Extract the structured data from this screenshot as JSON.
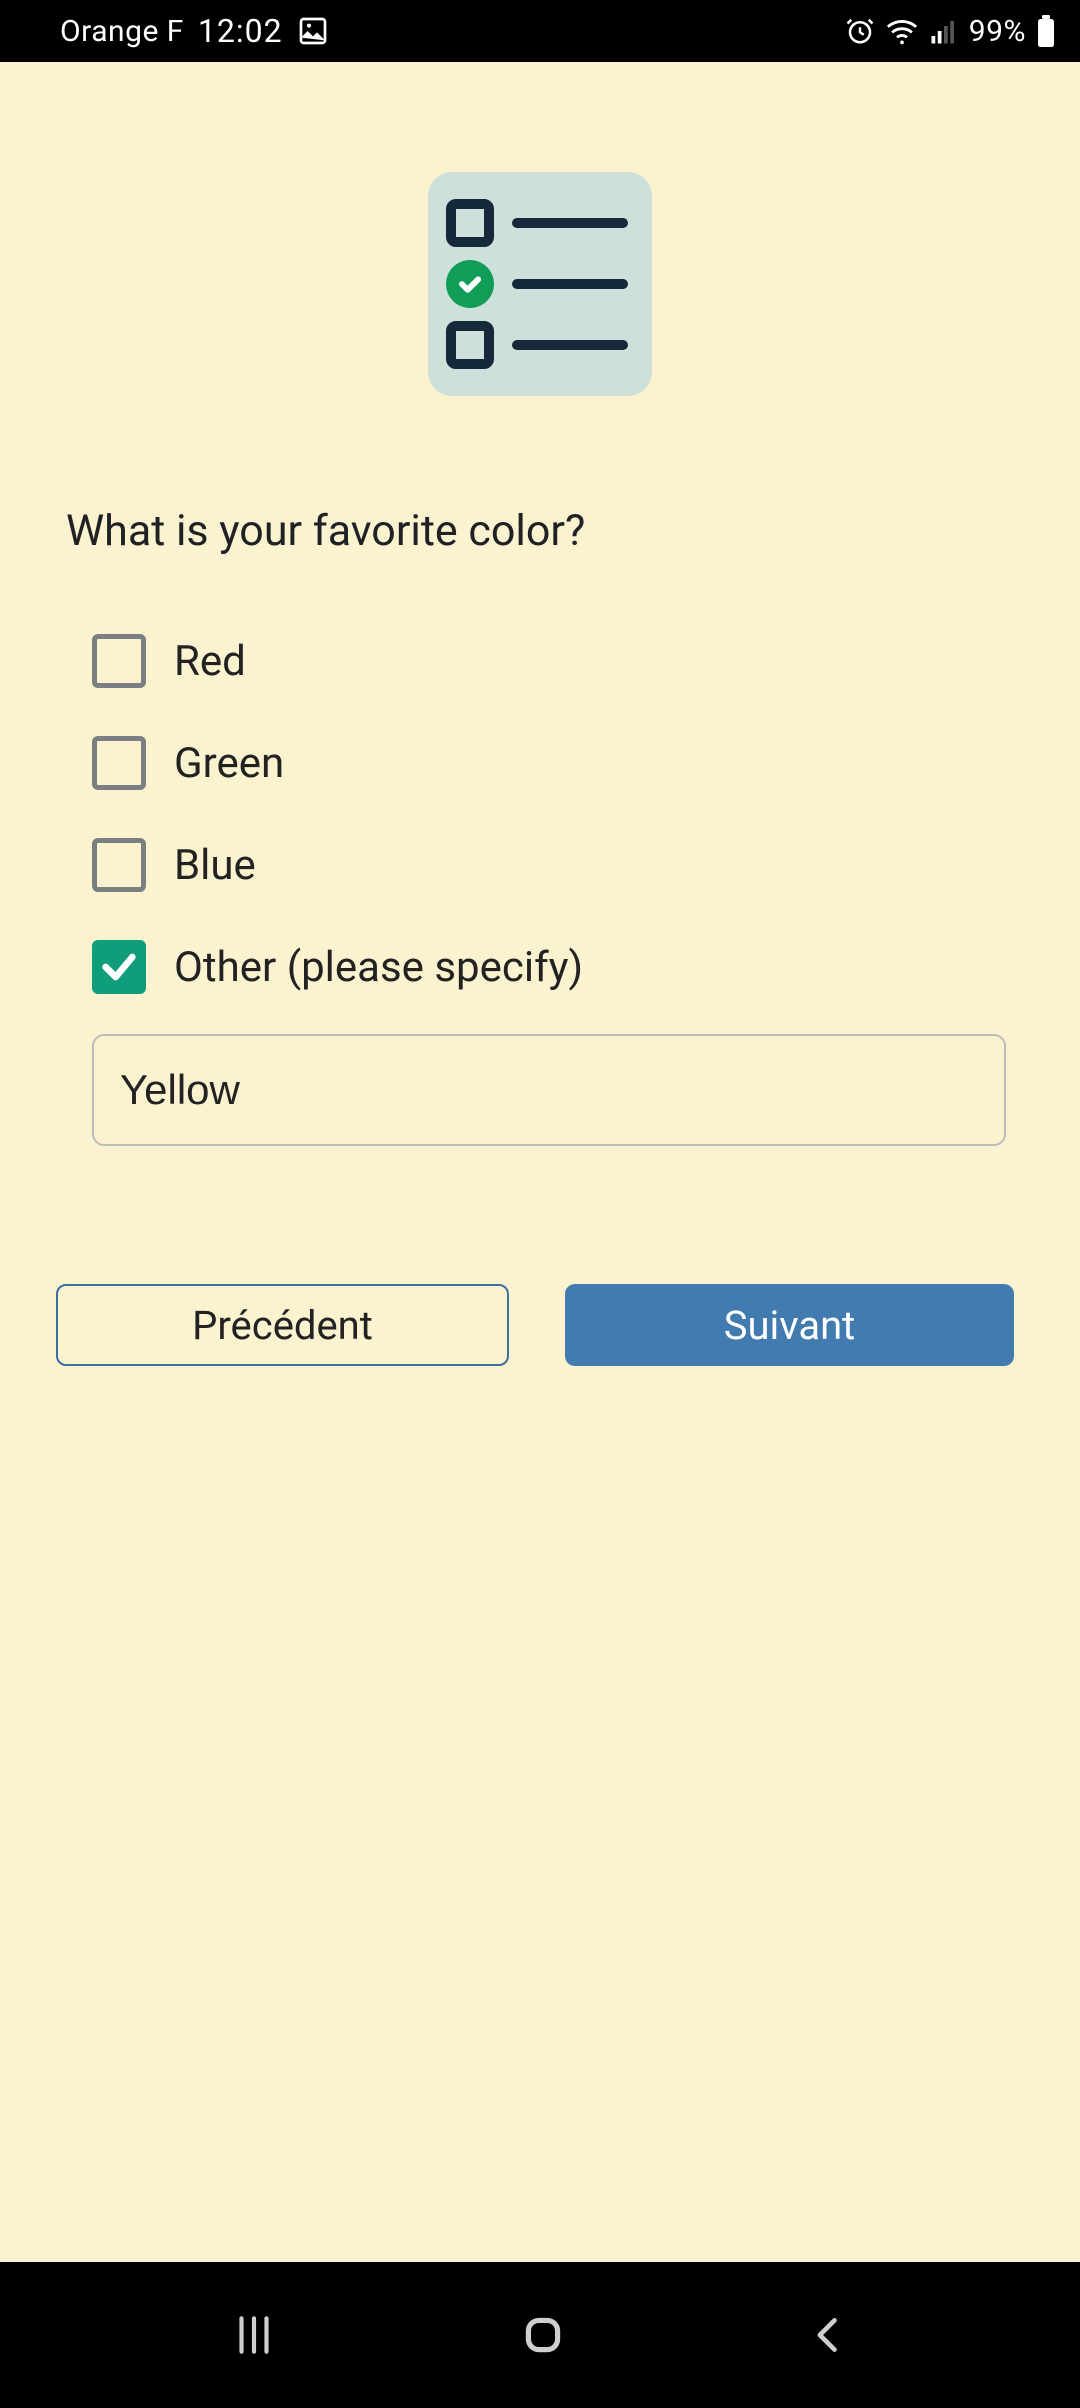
{
  "status": {
    "carrier": "Orange F",
    "time": "12:02",
    "battery_pct": "99%"
  },
  "survey": {
    "question": "What is your favorite color?",
    "options": [
      {
        "label": "Red",
        "checked": false
      },
      {
        "label": "Green",
        "checked": false
      },
      {
        "label": "Blue",
        "checked": false
      },
      {
        "label": "Other (please specify)",
        "checked": true
      }
    ],
    "other_value": "Yellow"
  },
  "nav": {
    "prev_label": "Précédent",
    "next_label": "Suivant"
  }
}
